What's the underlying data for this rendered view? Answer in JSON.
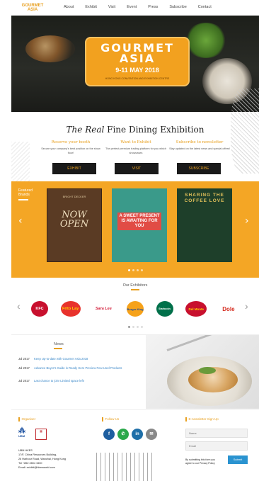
{
  "nav": {
    "logo_top": "GOURMET",
    "logo_bottom": "ASIA",
    "links": [
      "About",
      "Exhibit",
      "Visit",
      "Event",
      "Press",
      "Subscribe",
      "Contact"
    ]
  },
  "hero": {
    "title": "GOURMET ASIA",
    "date": "9-11 MAY 2018",
    "venue": "HONG KONG CONVENTION AND EXHIBITION CENTRE"
  },
  "intro": {
    "title_italic": "The Real",
    "title_rest": " Fine Dining Exhibition",
    "columns": [
      {
        "heading": "Reserve your booth",
        "desc": "Secure your company's best position on the show floor!",
        "button": "EXHIBIT"
      },
      {
        "heading": "Want to Exhibit",
        "desc": "The perfect premium trading platform for you which showcases",
        "button": "VISIT"
      },
      {
        "heading": "Subscribe to newsletter",
        "desc": "Stay updated on the latest news and special offers!",
        "button": "SUBSCRIBE"
      }
    ]
  },
  "featured": {
    "label_line1": "Featured",
    "label_line2": "Brands",
    "posters": [
      {
        "top": "BRIGHT DECKER",
        "text": "NOW OPEN"
      },
      {
        "text": "A SWEET PRESENT IS AWAITING FOR YOU"
      },
      {
        "text": "SHARING THE COFFEE LOVE"
      }
    ]
  },
  "exhibitors": {
    "title": "Our Exhibitors",
    "logos": [
      "KFC",
      "Frito Lay",
      "Sara Lee",
      "Burger King",
      "Starbucks",
      "Del Monte",
      "Dole"
    ]
  },
  "news": {
    "title": "News",
    "items": [
      {
        "date": "Jul 2017",
        "text": "Keep Up-to-date with Gourmet Asia 2018"
      },
      {
        "date": "Jul 2017",
        "text": "Advance Buyer's Guide is Ready Here Preview Fea-tured Products"
      },
      {
        "date": "Jul 2017",
        "text": "Last chance to join! Limited space left!"
      }
    ]
  },
  "footer": {
    "organiser_heading": "Organiser",
    "follow_heading": "Follow Us",
    "newsletter_heading": "E-newsletter Sign Up",
    "ubm_label": "UBM",
    "address": [
      "UBM HKES",
      "17/F, China Resources Building,",
      "26 Harbour Road, Wanchai, Hong Kong",
      "Tel +852 2804 1500",
      "Email: exhibit@hkesworld.com"
    ],
    "name_placeholder": "Name",
    "email_placeholder": "Email",
    "agree_text": "By submitting this form you agree to our Privacy Policy",
    "submit_label": "Submit"
  }
}
